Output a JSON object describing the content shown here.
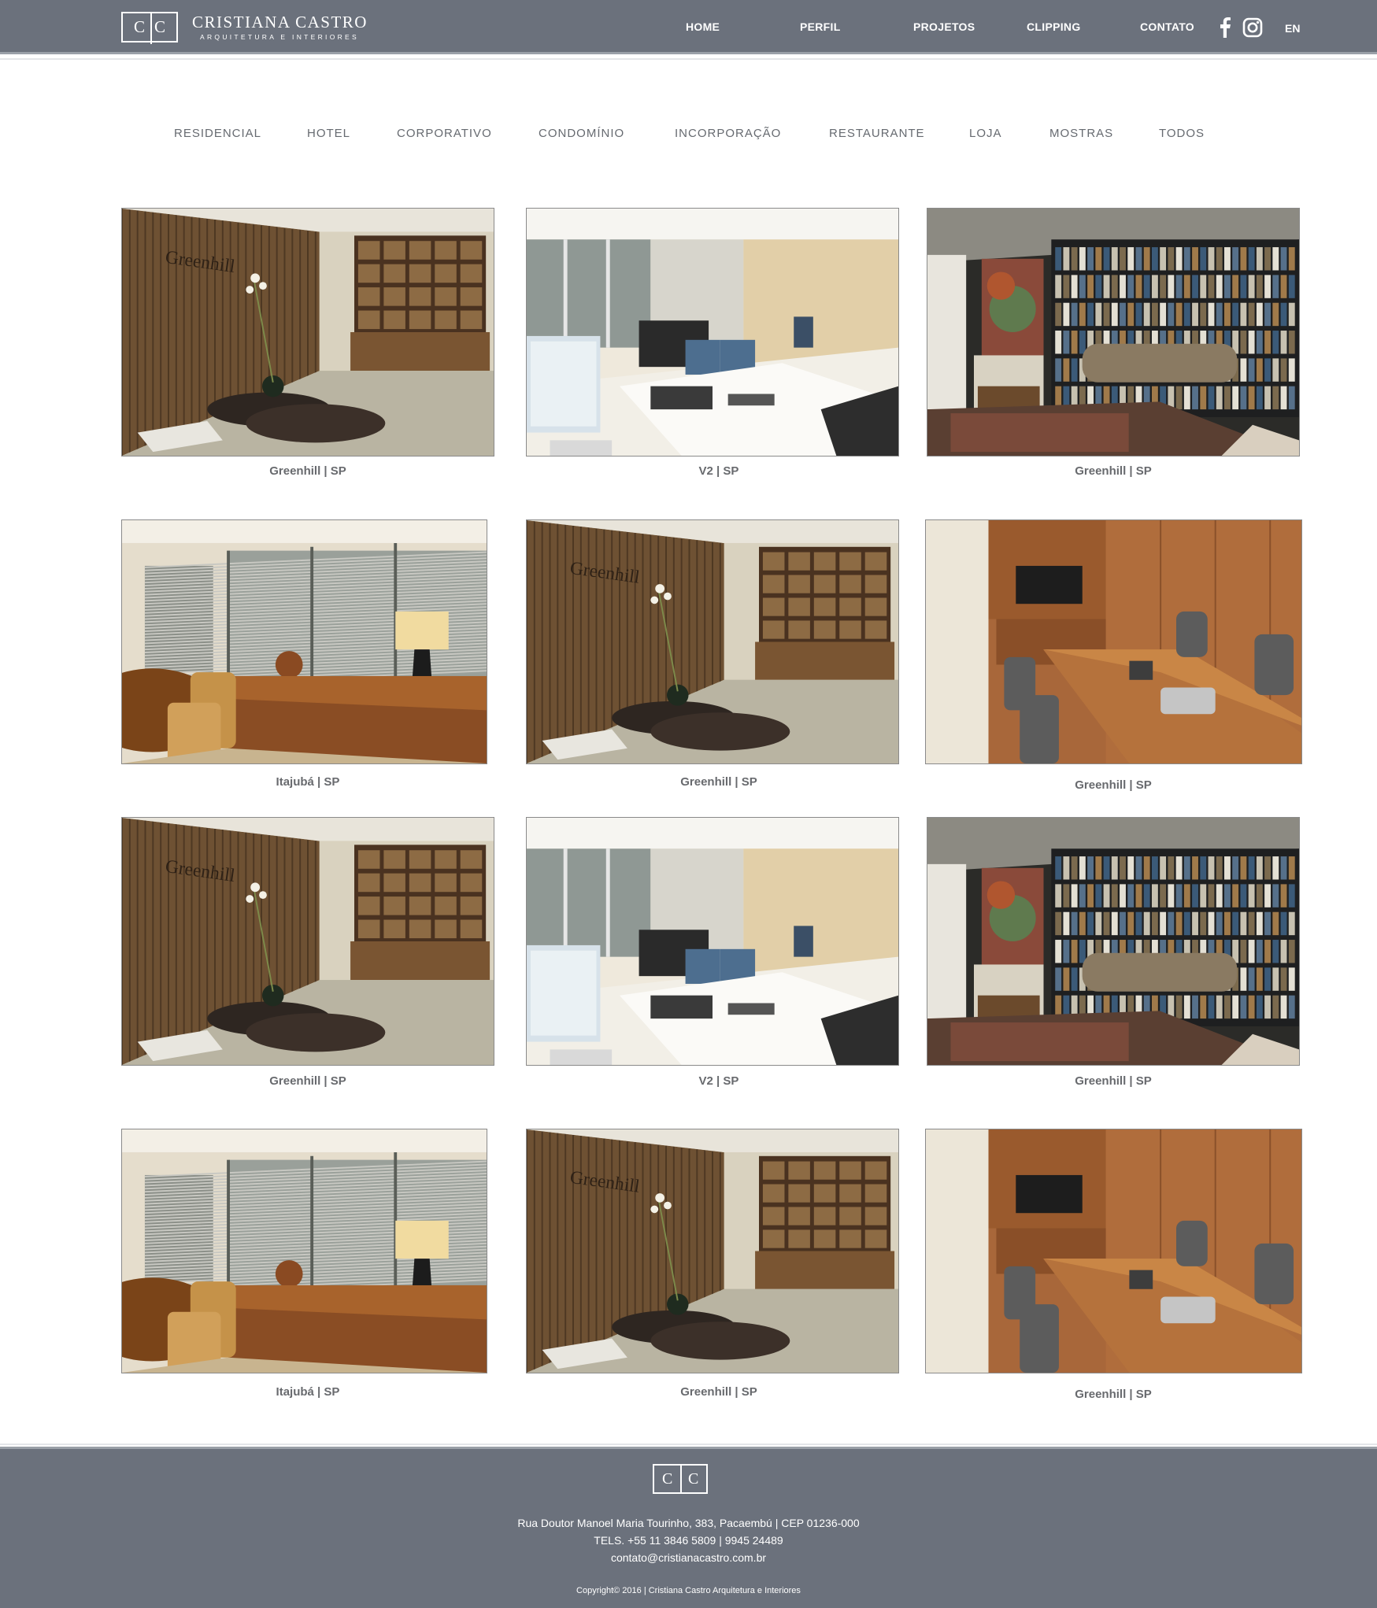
{
  "brand": {
    "monogram_left": "C",
    "monogram_right": "C",
    "name": "CRISTIANA CASTRO",
    "tagline": "ARQUITETURA E INTERIORES"
  },
  "nav": {
    "items": [
      "HOME",
      "PERFIL",
      "PROJETOS",
      "CLIPPING",
      "CONTATO"
    ],
    "language": "EN",
    "social_icons": [
      "facebook-icon",
      "instagram-icon"
    ]
  },
  "filters": [
    "RESIDENCIAL",
    "HOTEL",
    "CORPORATIVO",
    "CONDOMÍNIO",
    "INCORPORAÇÃO",
    "RESTAURANTE",
    "LOJA",
    "MOSTRAS",
    "TODOS"
  ],
  "projects": [
    {
      "caption": "Greenhill | SP",
      "scene": "lobby"
    },
    {
      "caption": "V2 | SP",
      "scene": "office"
    },
    {
      "caption": "Greenhill | SP",
      "scene": "library"
    },
    {
      "caption": "Itajubá | SP",
      "scene": "window"
    },
    {
      "caption": "Greenhill | SP",
      "scene": "lobby"
    },
    {
      "caption": "Greenhill | SP",
      "scene": "meeting"
    },
    {
      "caption": "Greenhill | SP",
      "scene": "lobby"
    },
    {
      "caption": "V2 | SP",
      "scene": "office"
    },
    {
      "caption": "Greenhill | SP",
      "scene": "library"
    },
    {
      "caption": "Itajubá | SP",
      "scene": "window"
    },
    {
      "caption": "Greenhill | SP",
      "scene": "lobby"
    },
    {
      "caption": "Greenhill | SP",
      "scene": "meeting"
    }
  ],
  "footer": {
    "address": "Rua Doutor Manoel Maria Tourinho, 383, Pacaembú  | CEP 01236-000",
    "phones": "TELS. +55 11 3846 5809 |  9945 24489",
    "email": "contato@cristianacastro.com.br",
    "copyright": "Copyright© 2016 | Cristiana Castro Arquitetura e Interiores"
  },
  "colors": {
    "header_bg": "#6b717c",
    "footer_bg": "#6b717c",
    "text_gray": "#686a6e"
  }
}
